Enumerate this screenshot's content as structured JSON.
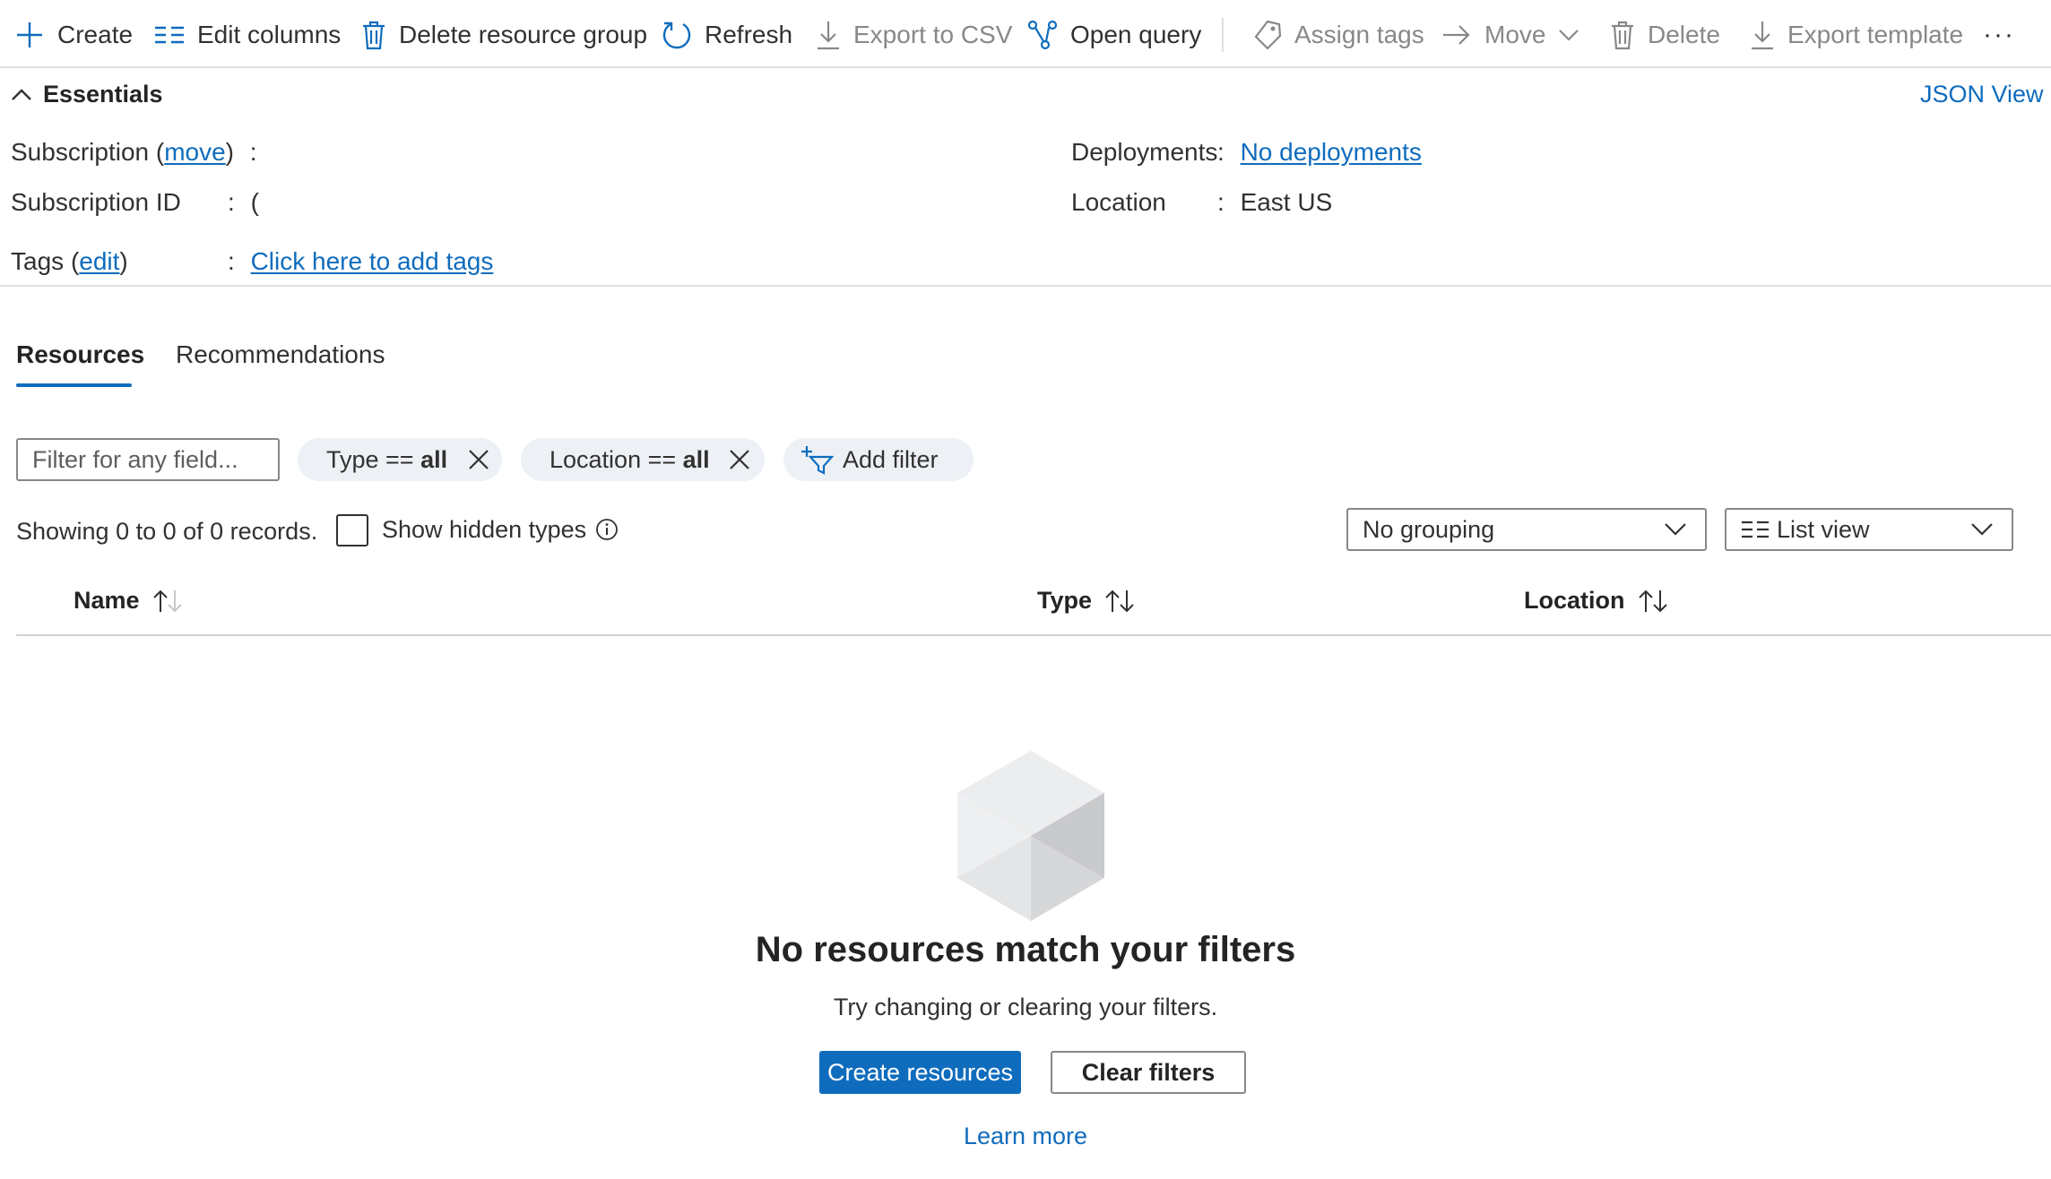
{
  "toolbar": {
    "create": "Create",
    "edit_columns": "Edit columns",
    "delete_group": "Delete resource group",
    "refresh": "Refresh",
    "export_csv": "Export to CSV",
    "open_query": "Open query",
    "assign_tags": "Assign tags",
    "move": "Move",
    "delete": "Delete",
    "export_template": "Export template",
    "more": "···"
  },
  "essentials": {
    "title": "Essentials",
    "json_view": "JSON View",
    "subscription_label": "Subscription",
    "move_link": "move",
    "subscription_value": "",
    "subscription_id_label": "Subscription ID",
    "subscription_id_value": "(",
    "tags_label": "Tags",
    "edit_link": "edit",
    "tags_value": "Click here to add tags",
    "deployments_label": "Deployments",
    "deployments_value": "No deployments",
    "location_label": "Location",
    "location_value": "East US",
    "colon": ":"
  },
  "tabs": [
    {
      "label": "Resources",
      "active": true
    },
    {
      "label": "Recommendations",
      "active": false
    }
  ],
  "filters": {
    "placeholder": "Filter for any field...",
    "type_prefix": "Type == ",
    "type_value": "all",
    "location_prefix": "Location == ",
    "location_value": "all",
    "add_filter": "Add filter"
  },
  "records": {
    "showing": "Showing 0 to 0 of 0 records.",
    "show_hidden": "Show hidden types",
    "grouping": "No grouping",
    "view": "List view"
  },
  "table": {
    "columns": [
      "Name",
      "Type",
      "Location"
    ]
  },
  "empty_state": {
    "title": "No resources match your filters",
    "subtitle": "Try changing or clearing your filters.",
    "create_button": "Create resources",
    "clear_button": "Clear filters",
    "learn_more": "Learn more"
  },
  "colors": {
    "accent": "#0f6cbd",
    "pill_bg": "#edf1f6",
    "border": "#e1dfdd"
  }
}
